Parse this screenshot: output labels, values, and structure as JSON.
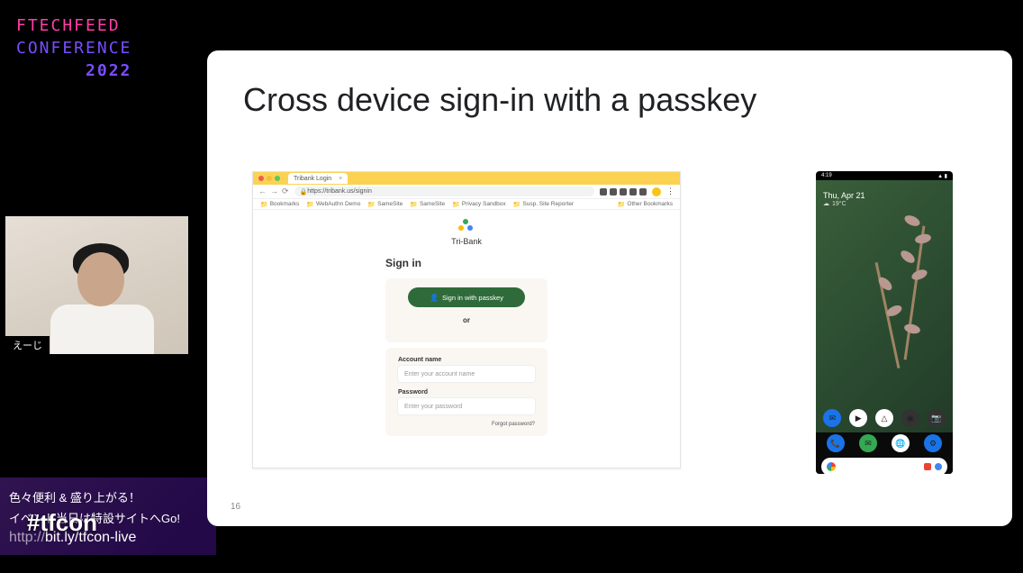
{
  "conference": {
    "line1": "FTECHFEED",
    "line2": "CONFERENCE",
    "year": "2022"
  },
  "speaker": {
    "name": "えーじ"
  },
  "promo": {
    "line1": "色々便利 & 盛り上がる！",
    "line2": "イベント当日は特設サイトへGo!",
    "url_prefix": "http://",
    "url": "bit.ly/tfcon-live"
  },
  "hashtag": "#tfcon",
  "slide": {
    "title": "Cross device sign-in with a passkey",
    "number": "16"
  },
  "browser": {
    "tab_title": "Tribank Login",
    "url": "https://tribank.us/signin",
    "bookmarks": [
      "Bookmarks",
      "WebAuthn Demo",
      "SameSite",
      "SameSite",
      "Privacy Sandbox",
      "Susp. Site Reporter"
    ],
    "other_bookmarks": "Other Bookmarks",
    "brand": "Tri-Bank",
    "signin": {
      "heading": "Sign in",
      "passkey_button": "Sign in with passkey",
      "or": "or",
      "account_label": "Account name",
      "account_placeholder": "Enter your account name",
      "password_label": "Password",
      "password_placeholder": "Enter your password",
      "forgot": "Forgot password?"
    }
  },
  "phone": {
    "time": "4:19",
    "date": "Thu, Apr 21",
    "temp": "19°C",
    "apps_row1": [
      "Messages",
      "Play Store",
      "Drive",
      "Photos",
      "Camera"
    ],
    "apps_dock": [
      "Phone",
      "Messages",
      "Chrome",
      "Settings"
    ]
  }
}
